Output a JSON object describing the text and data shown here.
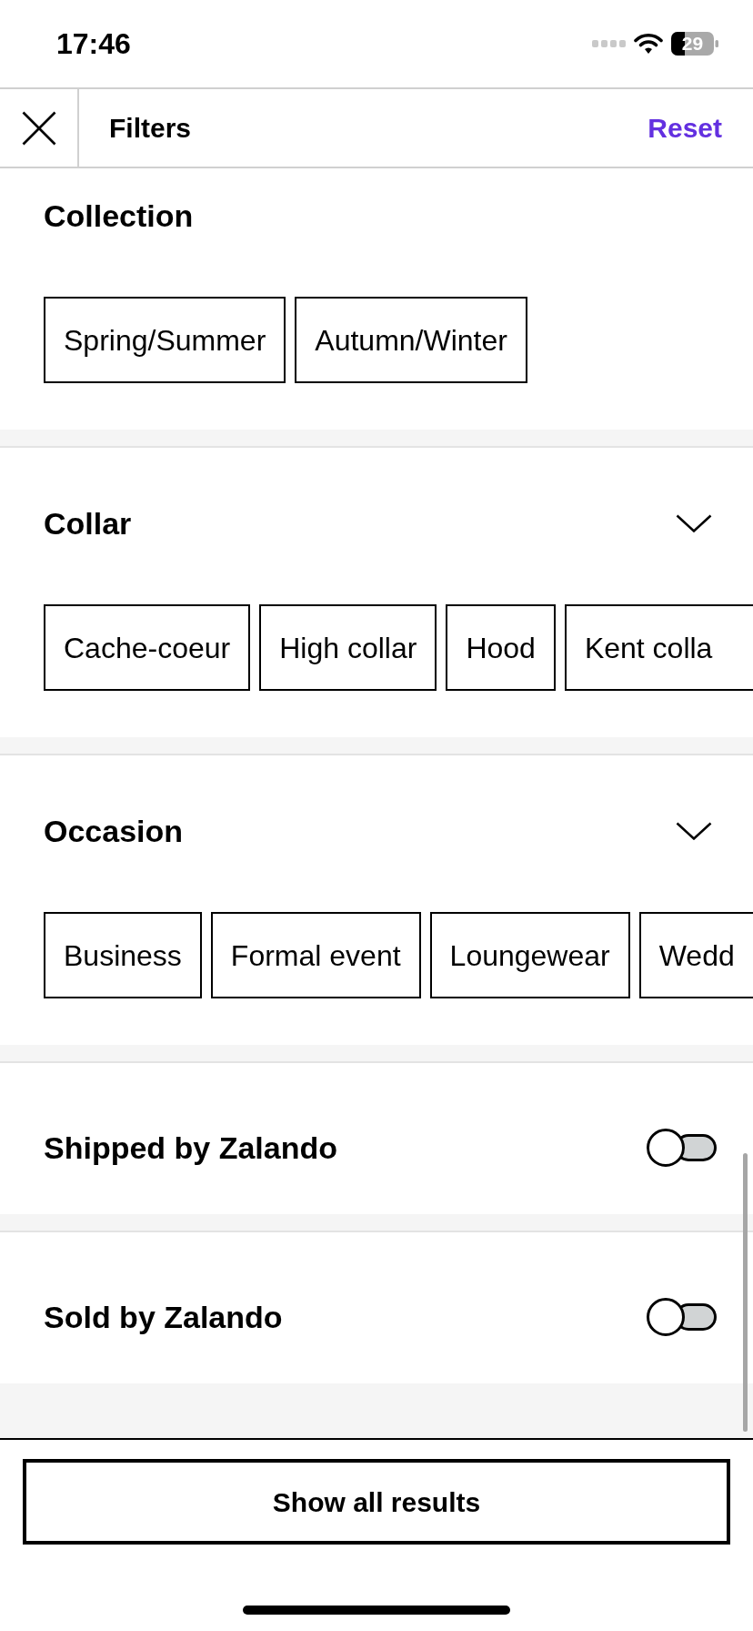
{
  "status_bar": {
    "time": "17:46",
    "battery": "29"
  },
  "header": {
    "title": "Filters",
    "reset": "Reset"
  },
  "sections": [
    {
      "kind": "chips",
      "title": "Collection",
      "collapsible": false,
      "more_offscreen": false,
      "options": [
        {
          "label": "Spring/Summer",
          "selected": false
        },
        {
          "label": "Autumn/Winter",
          "selected": false
        }
      ]
    },
    {
      "kind": "chips",
      "title": "Collar",
      "collapsible": true,
      "more_offscreen": true,
      "options": [
        {
          "label": "Cache-coeur",
          "selected": false
        },
        {
          "label": "High collar",
          "selected": false
        },
        {
          "label": "Hood",
          "selected": false
        },
        {
          "label": "Kent colla",
          "selected": false
        }
      ]
    },
    {
      "kind": "chips",
      "title": "Occasion",
      "collapsible": true,
      "more_offscreen": true,
      "options": [
        {
          "label": "Business",
          "selected": false
        },
        {
          "label": "Formal event",
          "selected": false
        },
        {
          "label": "Loungewear",
          "selected": false
        },
        {
          "label": "Wedd",
          "selected": false
        }
      ]
    },
    {
      "kind": "toggle",
      "title": "Shipped by Zalando",
      "on": false
    },
    {
      "kind": "toggle",
      "title": "Sold by Zalando",
      "on": false
    }
  ],
  "footer": {
    "button": "Show all results"
  }
}
